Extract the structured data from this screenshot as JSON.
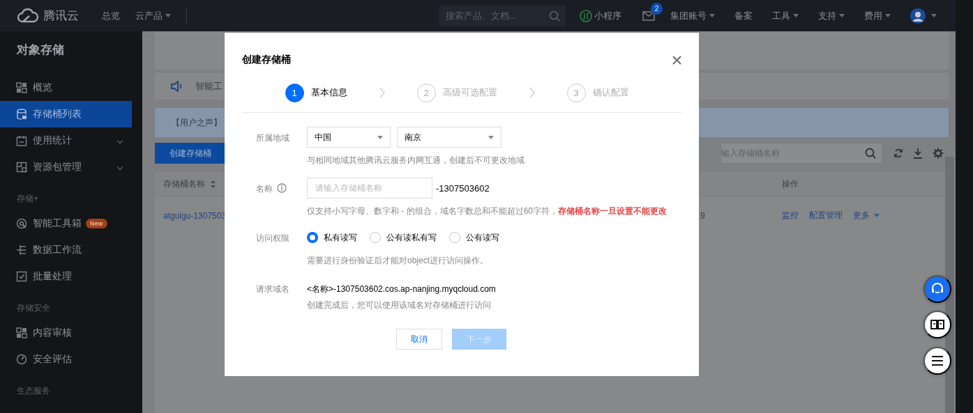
{
  "topbar": {
    "logo_text": "腾讯云",
    "nav": [
      {
        "label": "总览",
        "caret": false
      },
      {
        "label": "云产品",
        "caret": true
      }
    ],
    "search": {
      "placeholder": "搜索产品、文档..."
    },
    "mini_program": "小程序",
    "mail_badge": "2",
    "menus": [
      {
        "label": "集团账号",
        "caret": true
      },
      {
        "label": "备案",
        "caret": false
      },
      {
        "label": "工具",
        "caret": true
      },
      {
        "label": "支持",
        "caret": true
      },
      {
        "label": "费用",
        "caret": true
      }
    ]
  },
  "sidebar": {
    "title": "对象存储",
    "groups": [
      {
        "items": [
          {
            "label": "概览",
            "selected": false,
            "expandable": false
          },
          {
            "label": "存储桶列表",
            "selected": true,
            "expandable": false
          },
          {
            "label": "使用统计",
            "selected": false,
            "expandable": true
          },
          {
            "label": "资源包管理",
            "selected": false,
            "expandable": true
          }
        ]
      },
      {
        "heading": "存储+",
        "items": [
          {
            "label": "智能工具箱",
            "selected": false,
            "expandable": false,
            "badge": "New"
          },
          {
            "label": "数据工作流",
            "selected": false,
            "expandable": false
          },
          {
            "label": "批量处理",
            "selected": false,
            "expandable": false
          }
        ]
      },
      {
        "heading": "存储安全",
        "items": [
          {
            "label": "内容审核",
            "selected": false,
            "expandable": false
          },
          {
            "label": "安全评估",
            "selected": false,
            "expandable": false
          }
        ]
      },
      {
        "heading": "生态服务"
      }
    ]
  },
  "main": {
    "notice": "智能工",
    "user_voice": "【用户之声】",
    "create_button": "创建存储桶",
    "search": {
      "placeholder": "输入存储桶名称"
    },
    "table": {
      "columns": [
        {
          "label": "存储桶名称",
          "sortable": true
        },
        {
          "label": "操作",
          "sortable": false
        }
      ],
      "rows": [
        {
          "name": "atguigu-1307503",
          "column_2": "9",
          "actions": [
            {
              "label": "监控",
              "caret": false
            },
            {
              "label": "配置管理",
              "caret": false
            },
            {
              "label": "更多",
              "caret": true
            }
          ]
        }
      ]
    }
  },
  "modal": {
    "title": "创建存储桶",
    "steps": [
      {
        "number": "1",
        "label": "基本信息",
        "selected": true
      },
      {
        "number": "2",
        "label": "高级可选配置",
        "selected": false
      },
      {
        "number": "3",
        "label": "确认配置",
        "selected": false
      }
    ],
    "region": {
      "label": "所属地域",
      "selects": [
        "中国",
        "南京"
      ],
      "hint": "与相同地域其他腾讯云服务内网互通，创建后不可更改地域"
    },
    "name": {
      "label": "名称",
      "placeholder": "请输入存储桶名称",
      "suffix": "-1307503602",
      "hint": "仅支持小写字母、数字和 - 的组合，域名字数总和不能超过60字符，",
      "warning": "存储桶名称一旦设置不能更改"
    },
    "access": {
      "label": "访问权限",
      "options": [
        {
          "label": "私有读写",
          "selected": true
        },
        {
          "label": "公有读私有写",
          "selected": false
        },
        {
          "label": "公有读写",
          "selected": false
        }
      ],
      "hint": "需要进行身份验证后才能对object进行访问操作。"
    },
    "domain": {
      "label": "请求域名",
      "value": "<名称>-1307503602.cos.ap-nanjing.myqcloud.com",
      "hint": "创建完成后，您可以使用该域名对存储桶进行访问"
    },
    "buttons": [
      {
        "label": "取消",
        "kind": "secondary",
        "disabled": false
      },
      {
        "label": "下一步",
        "kind": "primary",
        "disabled": true
      }
    ]
  }
}
